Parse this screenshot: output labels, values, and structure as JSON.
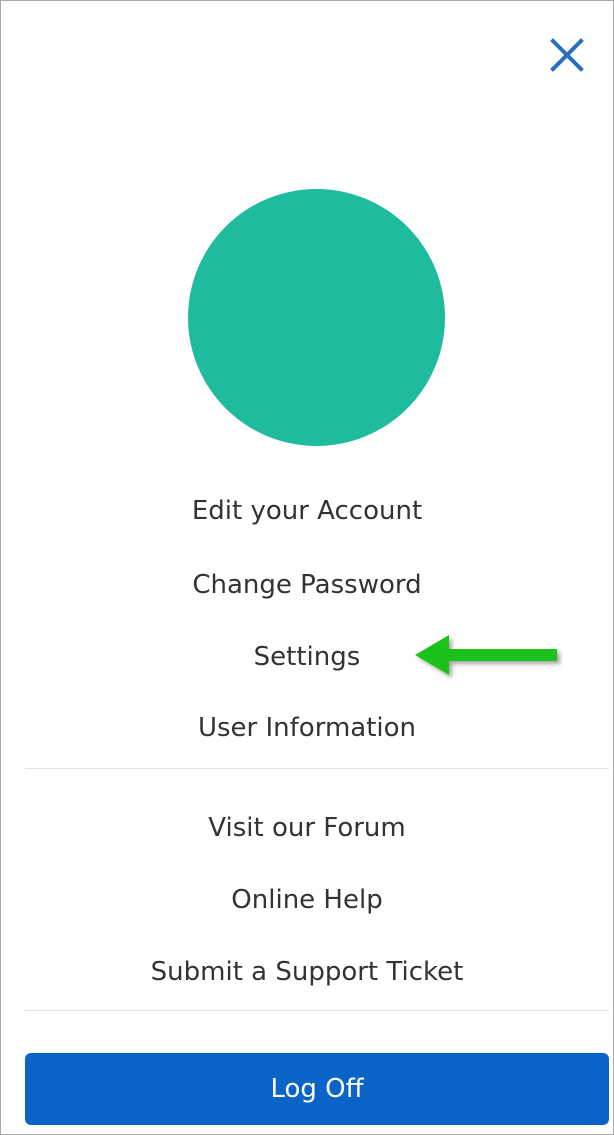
{
  "colors": {
    "avatar": "#1ebc9c",
    "close_icon": "#2a6ebf",
    "logoff_bg": "#0a63c7",
    "arrow": "#1ec21e"
  },
  "icons": {
    "close": "close-icon",
    "arrow": "arrow-left-icon"
  },
  "menu": {
    "account_section": [
      "Edit your Account",
      "Change Password",
      "Settings",
      "User Information"
    ],
    "support_section": [
      "Visit our Forum",
      "Online Help",
      "Submit a Support Ticket"
    ]
  },
  "logoff_label": "Log Off"
}
